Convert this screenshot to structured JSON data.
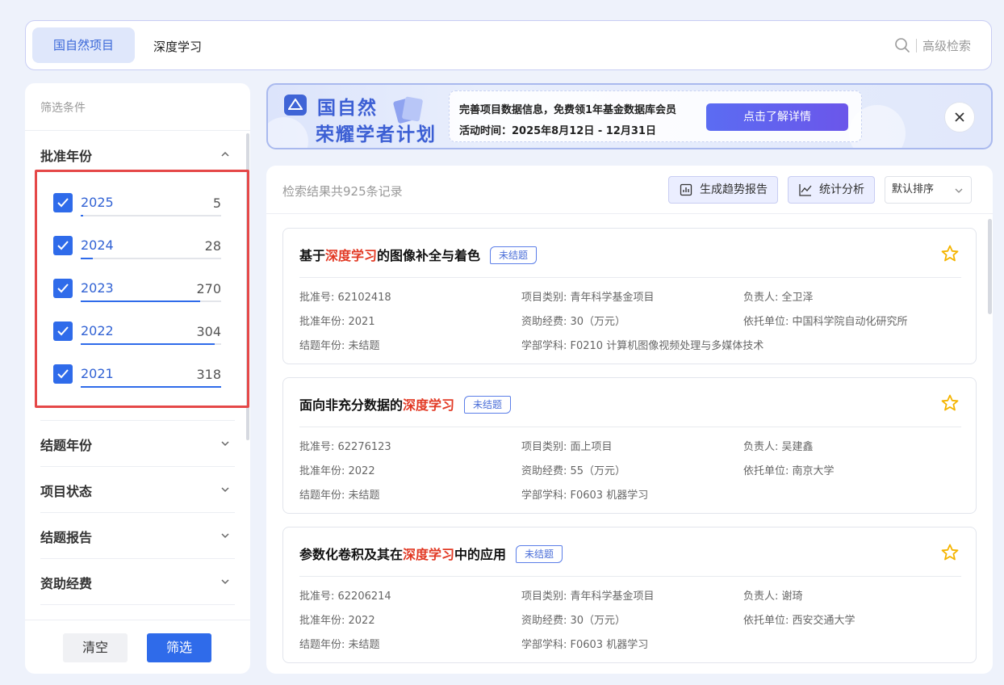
{
  "search": {
    "scope_tab": "国自然项目",
    "query": "深度学习",
    "advanced_label": "高级检索"
  },
  "sidebar": {
    "title": "筛选条件",
    "groups": [
      {
        "label": "批准年份",
        "expanded": true
      },
      {
        "label": "结题年份",
        "expanded": false
      },
      {
        "label": "项目状态",
        "expanded": false
      },
      {
        "label": "结题报告",
        "expanded": false
      },
      {
        "label": "资助经费",
        "expanded": false
      }
    ],
    "years": [
      {
        "year": "2025",
        "count": "5",
        "checked": true,
        "share": 0.016
      },
      {
        "year": "2024",
        "count": "28",
        "checked": true,
        "share": 0.088
      },
      {
        "year": "2023",
        "count": "270",
        "checked": true,
        "share": 0.849
      },
      {
        "year": "2022",
        "count": "304",
        "checked": true,
        "share": 0.956
      },
      {
        "year": "2021",
        "count": "318",
        "checked": true,
        "share": 1.0
      }
    ],
    "clear_label": "清空",
    "filter_label": "筛选"
  },
  "banner": {
    "title_line1": "国自然",
    "title_line2": "荣耀学者计划",
    "line1": "完善项目数据信息，免费领1年基金数据库会员",
    "line2": "活动时间：2025年8月12日 - 12月31日",
    "cta": "点击了解详情"
  },
  "results": {
    "count_text": "检索结果共925条记录",
    "trend_report_label": "生成趋势报告",
    "stats_label": "统计分析",
    "sort_label": "默认排序",
    "items": [
      {
        "title_pre": "基于",
        "title_hl": "深度学习",
        "title_post": "的图像补全与着色",
        "status": "未结题",
        "approval_no": "批准号: 62102418",
        "category": "项目类别: 青年科学基金项目",
        "leader": "负责人: 全卫泽",
        "approval_year": "批准年份: 2021",
        "funding": "资助经费: 30（万元）",
        "institution": "依托单位: 中国科学院自动化研究所",
        "end_year": "结题年份: 未结题",
        "discipline": "学部学科: F0210 计算机图像视频处理与多媒体技术"
      },
      {
        "title_pre": "面向非充分数据的",
        "title_hl": "深度学习",
        "title_post": "",
        "status": "未结题",
        "approval_no": "批准号: 62276123",
        "category": "项目类别: 面上项目",
        "leader": "负责人: 吴建鑫",
        "approval_year": "批准年份: 2022",
        "funding": "资助经费: 55（万元）",
        "institution": "依托单位: 南京大学",
        "end_year": "结题年份: 未结题",
        "discipline": "学部学科: F0603 机器学习"
      },
      {
        "title_pre": "参数化卷积及其在",
        "title_hl": "深度学习",
        "title_post": "中的应用",
        "status": "未结题",
        "approval_no": "批准号: 62206214",
        "category": "项目类别: 青年科学基金项目",
        "leader": "负责人: 谢琦",
        "approval_year": "批准年份: 2022",
        "funding": "资助经费: 30（万元）",
        "institution": "依托单位: 西安交通大学",
        "end_year": "结题年份: 未结题",
        "discipline": "学部学科: F0603 机器学习"
      }
    ]
  },
  "colors": {
    "accent": "#2f6bea",
    "highlight": "#e23a25",
    "selection_box": "#e54848",
    "star": "#f5b400"
  }
}
